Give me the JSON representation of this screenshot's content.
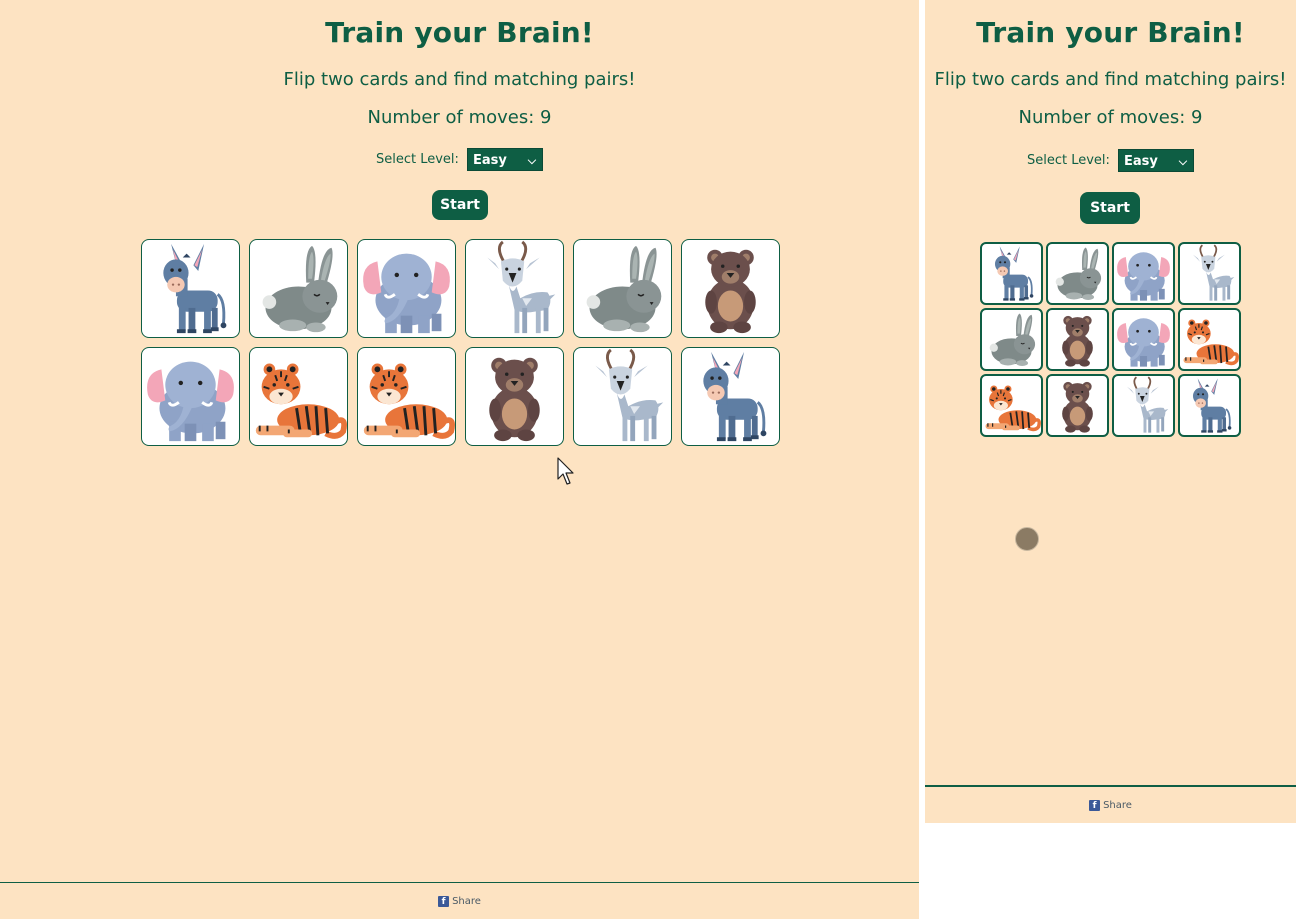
{
  "title": "Train your Brain!",
  "subtitle": "Flip two cards and find matching pairs!",
  "moves_label": "Number of moves: 9",
  "level": {
    "label": "Select Level:",
    "selected": "Easy"
  },
  "start_label": "Start",
  "share_label": "Share",
  "colors": {
    "background": "#fde3c2",
    "accent": "#0e5e44",
    "card": "#ffffff"
  },
  "desktop_cards": [
    "donkey",
    "rabbit",
    "elephant",
    "goat",
    "rabbit",
    "bear",
    "elephant",
    "tiger",
    "tiger",
    "bear",
    "goat",
    "donkey"
  ],
  "mobile_cards": [
    "donkey",
    "rabbit",
    "elephant",
    "goat",
    "rabbit",
    "bear",
    "elephant",
    "tiger",
    "tiger",
    "bear",
    "goat",
    "donkey"
  ]
}
